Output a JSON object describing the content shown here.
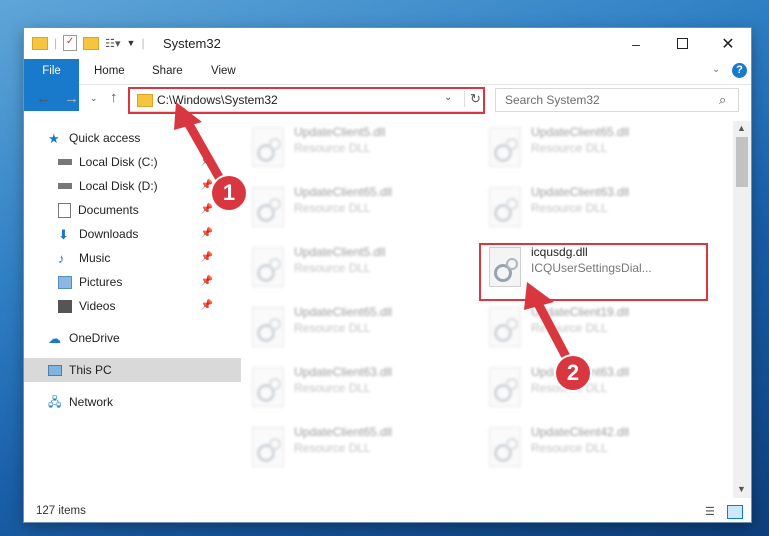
{
  "window": {
    "title": "System32"
  },
  "ribbon": {
    "tabs": [
      "File",
      "Home",
      "Share",
      "View"
    ]
  },
  "nav": {
    "address": "C:\\Windows\\System32",
    "search_placeholder": "Search System32"
  },
  "sidebar": {
    "items": [
      {
        "label": "Quick access",
        "icon": "star-icon",
        "pinned": false
      },
      {
        "label": "Local Disk (C:)",
        "icon": "drive-icon",
        "pinned": true
      },
      {
        "label": "Local Disk (D:)",
        "icon": "drive-icon",
        "pinned": true
      },
      {
        "label": "Documents",
        "icon": "documents-icon",
        "pinned": true
      },
      {
        "label": "Downloads",
        "icon": "downloads-icon",
        "pinned": true
      },
      {
        "label": "Music",
        "icon": "music-icon",
        "pinned": true
      },
      {
        "label": "Pictures",
        "icon": "pictures-icon",
        "pinned": true
      },
      {
        "label": "Videos",
        "icon": "videos-icon",
        "pinned": true
      },
      {
        "label": "OneDrive",
        "icon": "cloud-icon",
        "pinned": false
      },
      {
        "label": "This PC",
        "icon": "computer-icon",
        "pinned": false
      },
      {
        "label": "Network",
        "icon": "network-icon",
        "pinned": false
      }
    ]
  },
  "files": [
    {
      "name": "UpdateClient5.dll",
      "desc": "Resource DLL"
    },
    {
      "name": "UpdateClient65.dll",
      "desc": "Resource DLL"
    },
    {
      "name": "UpdateClient65.dll",
      "desc": "Resource DLL"
    },
    {
      "name": "UpdateClient63.dll",
      "desc": "Resource DLL"
    },
    {
      "name": "UpdateClient5.dll",
      "desc": "Resource DLL"
    },
    {
      "name": "icqusdg.dll",
      "desc": "ICQUserSettingsDial..."
    },
    {
      "name": "UpdateClient65.dll",
      "desc": "Resource DLL"
    },
    {
      "name": "UpdateClient19.dll",
      "desc": "Resource DLL"
    },
    {
      "name": "UpdateClient63.dll",
      "desc": "Resource DLL"
    },
    {
      "name": "UpdateClient63.dll",
      "desc": "Resource DLL"
    },
    {
      "name": "UpdateClient65.dll",
      "desc": "Resource DLL"
    },
    {
      "name": "UpdateClient42.dll",
      "desc": "Resource DLL"
    }
  ],
  "status": {
    "count": "127 items"
  },
  "markers": [
    "1",
    "2"
  ],
  "colors": {
    "accent": "#1979ca",
    "highlight": "#d9373f"
  }
}
